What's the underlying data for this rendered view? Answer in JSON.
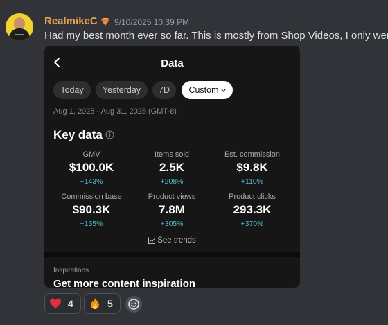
{
  "message": {
    "author": "RealmikeC",
    "timestamp": "9/10/2025 10:39 PM",
    "text": "Had my best month ever so far. This is mostly from Shop Videos, I only wer",
    "colors": {
      "author": "#e5a14d",
      "background": "#313338"
    }
  },
  "embed": {
    "title": "Data",
    "chips": [
      "Today",
      "Yesterday",
      "7D",
      "Custom"
    ],
    "active_chip": "Custom",
    "date_range": "Aug 1, 2025 - Aug 31, 2025 (GMT-8)",
    "section_title": "Key data",
    "metrics": [
      {
        "label": "GMV",
        "value": "$100.0K",
        "change": "+143%"
      },
      {
        "label": "Items sold",
        "value": "2.5K",
        "change": "+208%"
      },
      {
        "label": "Est. commission",
        "value": "$9.8K",
        "change": "+110%"
      },
      {
        "label": "Commission base",
        "value": "$90.3K",
        "change": "+135%"
      },
      {
        "label": "Product views",
        "value": "7.8M",
        "change": "+305%"
      },
      {
        "label": "Product clicks",
        "value": "293.3K",
        "change": "+370%"
      }
    ],
    "see_trends": "See trends",
    "inspirations_label": "Inspirations",
    "inspirations_title": "Get more content inspiration",
    "colors": {
      "change": "#4fb7c9"
    }
  },
  "reactions": [
    {
      "emoji": "red-heart-icon",
      "count": "4"
    },
    {
      "emoji": "fire-icon",
      "count": "5"
    }
  ],
  "icons": {
    "add_reaction": "smiley-icon",
    "badge": "gem-badge-icon"
  }
}
